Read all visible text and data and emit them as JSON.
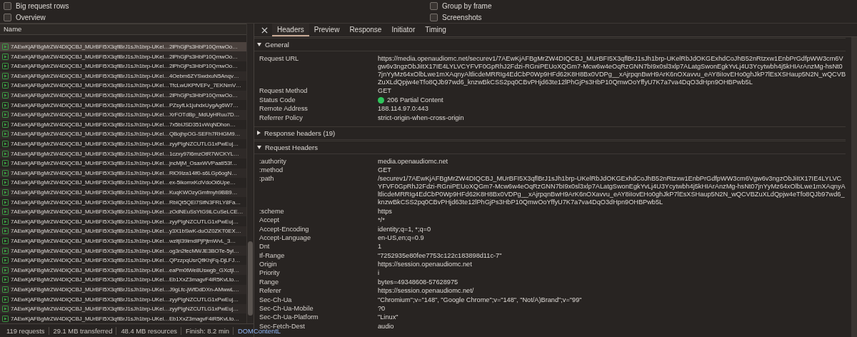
{
  "options_left": [
    {
      "label": "Big request rows",
      "checked": false
    },
    {
      "label": "Overview",
      "checked": false
    }
  ],
  "options_right": [
    {
      "label": "Group by frame",
      "checked": false
    },
    {
      "label": "Screenshots",
      "checked": false
    }
  ],
  "requests": {
    "column": "Name",
    "rows": [
      {
        "name": "7AEwKjAFBgMrZW4DIQCBJ_MUrBFI5X3qflBrJ1sJh1brp-UKel…2lPhGjPs3HbP10QmwOo…",
        "selected": true
      },
      {
        "name": "7AEwKjAFBgMrZW4DIQCBJ_MUrBFI5X3qflBrJ1sJh1brp-UKel…2lPhGjPs3HbP10QmwOo…",
        "selected": false
      },
      {
        "name": "7AEwKjAFBgMrZW4DIQCBJ_MUrBFI5X3qflBrJ1sJh1brp-UKel…2lPhGjPs3HbP10QmwOo…",
        "selected": false
      },
      {
        "name": "7AEwKjAFBgMrZW4DIQCBJ_MUrBFI5X3qflBrJ1sJh1brp-UKel…4Oebm6ZYSwdxuN5Anqv…",
        "selected": false
      },
      {
        "name": "7AEwKjAFBgMrZW4DIQCBJ_MUrBFI5X3qflBrJ1sJh1brp-UKel…TfcLwUKPfVEFv_7EKNmV…",
        "selected": false
      },
      {
        "name": "7AEwKjAFBgMrZW4DIQCBJ_MUrBFI5X3qflBrJ1sJh1brp-UKel…2lPhGjPs3HbP10QmwOo…",
        "selected": false
      },
      {
        "name": "7AEwKjAFBgMrZW4DIQCBJ_MUrBFI5X3qflBrJ1sJh1brp-UKel…PZsyfLk1juhdxUygAg6W7…",
        "selected": false
      },
      {
        "name": "7AEwKjAFBgMrZW4DIQCBJ_MUrBFI5X3qflBrJ1sJh1brp-UKel…XrFOTdBp_MdUyHRuu7D…",
        "selected": false
      },
      {
        "name": "7AEwKjAFBgMrZW4DIQCBJ_MUrBFI5X3qflBrJ1sJh1brp-UKel…7x5blJSD351vWqNDhon…",
        "selected": false
      },
      {
        "name": "7AEwKjAFBgMrZW4DIQCBJ_MUrBFI5X3qflBrJ1sJh1brp-UKel…QBojhpOG-SEFh7RHGM9…",
        "selected": false
      },
      {
        "name": "7AEwKjAFBgMrZW4DIQCBJ_MUrBFI5X3qflBrJ1sJh1brp-UKel…zyyPIgNZCUTLG1xPwEuj…",
        "selected": false
      },
      {
        "name": "7AEwKjAFBgMrZW4DIQCBJ_MUrBFI5X3qflBrJ1sJh1brp-UKel…1czxy97I6mzOtR7WCKYL…",
        "selected": false
      },
      {
        "name": "7AEwKjAFBgMrZW4DIQCBJ_MUrBFI5X3qflBrJ1sJh1brp-UKel…jncMjM_OsaxWVPaatI53f…",
        "selected": false
      },
      {
        "name": "7AEwKjAFBgMrZW4DIQCBJ_MUrBFI5X3qflBrJ1sJh1brp-UKel…RlO9lza14lf0-s6LGp6ogN…",
        "selected": false
      },
      {
        "name": "7AEwKjAFBgMrZW4DIQCBJ_MUrBFI5X3qflBrJ1sJh1brp-UKel…ex-5ikomxKclVdoOi6Upe…",
        "selected": false
      },
      {
        "name": "7AEwKjAFBgMrZW4DIQCBJ_MUrBFI5X3qflBrJ1sJh1brp-UKel…KuqKWOzyGmfmyh9BB9…",
        "selected": false
      },
      {
        "name": "7AEwKjAFBgMrZW4DIQCBJ_MUrBFI5X3qflBrJ1sJh1brp-UKel…RbIQt5QEi7SifN3FRLY8Fa…",
        "selected": false
      },
      {
        "name": "7AEwKjAFBgMrZW4DIQCBJ_MUrBFI5X3qflBrJ1sJh1brp-UKel…zOdNEuSsYtG9iLCuSeLCE…",
        "selected": false
      },
      {
        "name": "7AEwKjAFBgMrZW4DIQCBJ_MUrBFI5X3qflBrJ1sJh1brp-UKel…zyyPIgNZCUTLG1xPwEuj…",
        "selected": false
      },
      {
        "name": "7AEwKjAFBgMrZW4DIQCBJ_MUrBFI5X3qflBrJ1sJh1brp-UKel…y3X1bSwK-duOZ0ZKT0EX…",
        "selected": false
      },
      {
        "name": "7AEwKjAFBgMrZW4DIQCBJ_MUrBFI5X3qflBrJ1sJh1brp-UKel…wzltjI39imdlPjPjtmWvL_3…",
        "selected": false
      },
      {
        "name": "7AEwKjAFBgMrZW4DIQCBJ_MUrBFI5X3qflBrJ1sJh1brp-UKel…og3n2fecMWJE3BOTe-5yl…",
        "selected": false
      },
      {
        "name": "7AEwKjAFBgMrZW4DIQCBJ_MUrBFI5X3qflBrJ1sJh1brp-UKel…QPzzpqUsrQflKhjFq-DjLFJ…",
        "selected": false
      },
      {
        "name": "7AEwKjAFBgMrZW4DIQCBJ_MUrBFI5X3qflBrJ1sJh1brp-UKel…eaPm0tWe8Uswgb_GXctjl…",
        "selected": false
      },
      {
        "name": "7AEwKjAFBgMrZW4DIQCBJ_MUrBFI5X3qflBrJ1sJh1brp-UKel…Eb1XxZ3magvF4iR5KvLto…",
        "selected": false
      },
      {
        "name": "7AEwKjAFBgMrZW4DIQCBJ_MUrBFI5X3qflBrJ1sJh1brp-UKel…J9gLfc-jWfDdDXn-AMwwL…",
        "selected": false
      },
      {
        "name": "7AEwKjAFBgMrZW4DIQCBJ_MUrBFI5X3qflBrJ1sJh1brp-UKel…zyyPIgNZCUTLG1xPwEuj…",
        "selected": false
      },
      {
        "name": "7AEwKjAFBgMrZW4DIQCBJ_MUrBFI5X3qflBrJ1sJh1brp-UKel…zyyPIgNZCUTLG1xPwEuj…",
        "selected": false
      },
      {
        "name": "7AEwKjAFBgMrZW4DIQCBJ_MUrBFI5X3qflBrJ1sJh1brp-UKel…Eb1XxZ3magvF4iR5KvLto…",
        "selected": false
      }
    ]
  },
  "status_bar": [
    "119 requests",
    "29.1 MB transferred",
    "48.4 MB resources",
    "Finish: 8.2 min",
    "DOMContentL"
  ],
  "details": {
    "tabs": [
      {
        "label": "Headers",
        "selected": true
      },
      {
        "label": "Preview",
        "selected": false
      },
      {
        "label": "Response",
        "selected": false
      },
      {
        "label": "Initiator",
        "selected": false
      },
      {
        "label": "Timing",
        "selected": false
      }
    ],
    "sections": [
      {
        "title": "General",
        "expanded": true,
        "rows": [
          {
            "key": "Request URL",
            "value": "https://media.openaudiomc.net/securev1/7AEwKjAFBgMrZW4DIQCBJ_MUrBFI5X3qflBrJ1sJh1brp-UKelRbJdOKGExhdCoJhB52nRtzxw1EnbPrGdfpWW3cm6Vgw6v3ngzObJiItX17IE4LYLVCYFVF0GpRhJ2Fdzi-RGniPEUoXQGm7-Mcw6w4eOqRzGNN7bI9x0sl3xlp7ALatgSwonEgkYvLj4U3Ycytwbh4j5kHIArAnzMg-hsNt07jnYyMz64xOlbLwe1mXAqnyAltlicdeMRRIg4EdCbP0Wp9HFd62K8H8Bx0VDPg__xAjrpqnBwH9ArK6nOXavvu_eAY8iIovEHo0ghJkP7lEsXSHaup5N2N_wQCVBZuXLdQpjw4eTfo8QJb97wd6_knzwBkCSS2pq0CBvPHjd63te12lPhGjPs3HbP10QmwOoYffyU7K7a7va4DqO3dHpn9OHBPwb5L",
            "kind": "text"
          },
          {
            "key": "Request Method",
            "value": "GET",
            "kind": "text"
          },
          {
            "key": "Status Code",
            "value": "206 Partial Content",
            "kind": "status"
          },
          {
            "key": "Remote Address",
            "value": "188.114.97.0:443",
            "kind": "text"
          },
          {
            "key": "Referrer Policy",
            "value": "strict-origin-when-cross-origin",
            "kind": "text"
          }
        ]
      },
      {
        "title": "Response headers (19)",
        "expanded": false
      },
      {
        "title": "Request Headers",
        "expanded": true,
        "rows": [
          {
            "key": ":authority",
            "value": "media.openaudiomc.net",
            "kind": "text"
          },
          {
            "key": ":method",
            "value": "GET",
            "kind": "text"
          },
          {
            "key": ":path",
            "value": "/securev1/7AEwKjAFBgMrZW4DIQCBJ_MUrBFI5X3qflBrJ1sJh1brp-UKelRbJdOKGExhdCoJhB52nRtzxw1EnbPrGdfpWW3cm6Vgw6v3ngzObJiItX17IE4LYLVCYFVF0GpRhJ2Fdzi-RGniPEUoXQGm7-Mcw6w4eOqRzGNN7bI9x0sl3xlp7ALatgSwonEgkYvLj4U3Ycytwbh4j5kHIArAnzMg-hsNt07jnYyMz64xOlbLwe1mXAqnyAltlicdeMRRIg4EdCbP0Wp9HFd62K8H8Bx0VDPg__xAjrpqnBwH9ArK6nOXavvu_eAY8iIovEHo0ghJkP7lEsXSHaup5N2N_wQCVBZuXLdQpjw4eTfo8QJb97wd6_knzwBkCSS2pq0CBvPHjd63te12lPhGjPs3HbP10QmwOoYffyU7K7a7va4DqO3dHpn9OHBPwb5L",
            "kind": "text"
          },
          {
            "key": ":scheme",
            "value": "https",
            "kind": "text"
          },
          {
            "key": "Accept",
            "value": "*/*",
            "kind": "text"
          },
          {
            "key": "Accept-Encoding",
            "value": "identity;q=1, *;q=0",
            "kind": "text"
          },
          {
            "key": "Accept-Language",
            "value": "en-US,en;q=0.9",
            "kind": "text"
          },
          {
            "key": "Dnt",
            "value": "1",
            "kind": "text"
          },
          {
            "key": "If-Range",
            "value": "\"7252935e80fee7753c122c183898d11c-7\"",
            "kind": "text"
          },
          {
            "key": "Origin",
            "value": "https://session.openaudiomc.net",
            "kind": "text"
          },
          {
            "key": "Priority",
            "value": "i",
            "kind": "text"
          },
          {
            "key": "Range",
            "value": "bytes=49348608-57628975",
            "kind": "text"
          },
          {
            "key": "Referer",
            "value": "https://session.openaudiomc.net/",
            "kind": "text"
          },
          {
            "key": "Sec-Ch-Ua",
            "value": "\"Chromium\";v=\"148\", \"Google Chrome\";v=\"148\", \"Not/A)Brand\";v=\"99\"",
            "kind": "text"
          },
          {
            "key": "Sec-Ch-Ua-Mobile",
            "value": "?0",
            "kind": "text"
          },
          {
            "key": "Sec-Ch-Ua-Platform",
            "value": "\"Linux\"",
            "kind": "text"
          },
          {
            "key": "Sec-Fetch-Dest",
            "value": "audio",
            "kind": "text"
          }
        ]
      }
    ]
  }
}
